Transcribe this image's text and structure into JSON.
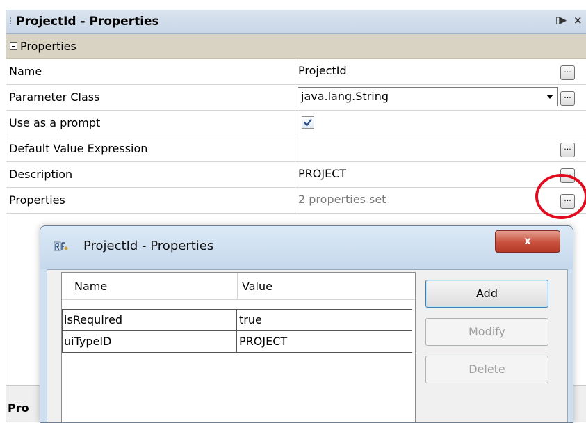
{
  "panel": {
    "title": "ProjectId - Properties",
    "pin_icon": "pin-icon",
    "close_icon": "close-icon",
    "close_glyph": "×",
    "category": "Properties",
    "rows": [
      {
        "name": "Name",
        "value": "ProjectId"
      },
      {
        "name": "Parameter Class",
        "value": "java.lang.String"
      },
      {
        "name": "Use as a prompt",
        "checked": true
      },
      {
        "name": "Default Value Expression",
        "value": ""
      },
      {
        "name": "Description",
        "value": "PROJECT"
      },
      {
        "name": "Properties",
        "value": "2 properties set"
      }
    ],
    "ellipsis_label": "...",
    "bottom_label": "Pro"
  },
  "annotation_color": "#e10b1f",
  "dialog": {
    "title": "ProjectId - Properties",
    "close_label": "x",
    "table": {
      "columns": [
        "Name",
        "Value"
      ],
      "rows": [
        {
          "name": "isRequired",
          "value": "true"
        },
        {
          "name": "uiTypeID",
          "value": "PROJECT"
        }
      ]
    },
    "buttons": {
      "add": "Add",
      "modify": "Modify",
      "delete": "Delete"
    }
  }
}
